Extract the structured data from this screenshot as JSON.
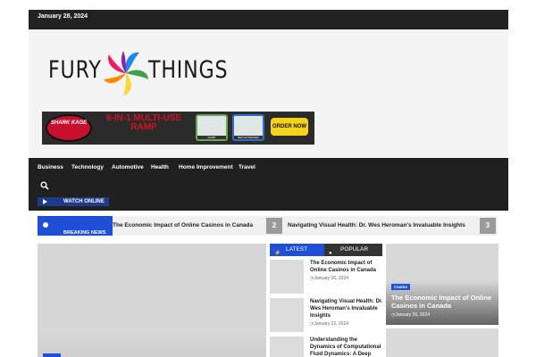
{
  "topbar": {
    "date": "January 28, 2024"
  },
  "logo": {
    "word1": "FURY",
    "word2": "THINGS",
    "colors": [
      "#e91e63",
      "#1e88e5",
      "#43a047",
      "#fdd835",
      "#fb8c00",
      "#8e24aa"
    ]
  },
  "banner": {
    "brand": "SHARK KAGE",
    "headline": "6-IN-1 MULTI-USE RAMP",
    "tag1": "RAMP",
    "tag2": "BED EXTENDER",
    "cta": "ORDER NOW"
  },
  "nav": {
    "items": [
      "Business",
      "Technology",
      "Automotive",
      "Health",
      "Home Improvement",
      "Travel"
    ],
    "search_icon": "search-icon",
    "watch_label": "WATCH ONLINE"
  },
  "ticker": {
    "label": "BREAKING NEWS",
    "items": [
      {
        "title": "The Economic Impact of Online Casinos in Canada"
      },
      {
        "num": "2",
        "title": "Navigating Visual Health: Dr. Wes Heroman's Invaluable Insights"
      },
      {
        "num": "3"
      }
    ]
  },
  "tabs": {
    "latest": "LATEST",
    "popular": "POPULAR"
  },
  "latest_posts": [
    {
      "title": "The Economic Impact of Online Casinos in Canada",
      "date": "January 26, 2024"
    },
    {
      "title": "Navigating Visual Health: Dr. Wes Heroman's Invaluable Insights",
      "date": "January 22, 2024"
    },
    {
      "title": "Understanding the Dynamics of Computational Fluid Dynamics: A Deep Dive into"
    }
  ],
  "card": {
    "category": "Casino",
    "title": "The Economic Impact of Online Casinos in Canada",
    "date": "January 26, 2024"
  },
  "colors": {
    "accent": "#1e4fd6",
    "dark": "#202020",
    "topbar": "#222222"
  }
}
